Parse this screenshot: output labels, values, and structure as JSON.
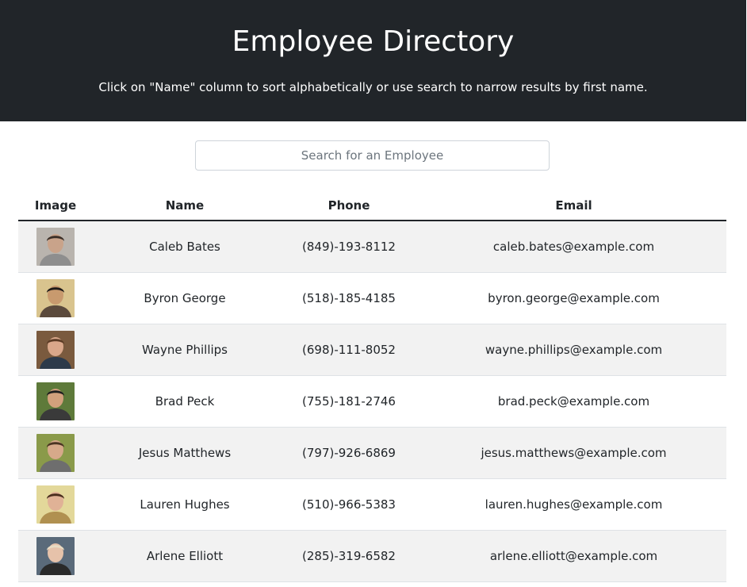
{
  "header": {
    "title": "Employee Directory",
    "subtitle": "Click on \"Name\" column to sort alphabetically or use search to narrow results by first name.",
    "background": "#212529"
  },
  "search": {
    "placeholder": "Search for an Employee",
    "value": ""
  },
  "table": {
    "columns": [
      "Image",
      "Name",
      "Phone",
      "Email"
    ],
    "rows": [
      {
        "name": "Caleb Bates",
        "phone": "(849)-193-8112",
        "email": "caleb.bates@example.com",
        "avatar": {
          "bg": "#b9b4ae",
          "skin": "#c9a38a",
          "hair": "#3a2e27",
          "shirt": "#8e8e8e"
        }
      },
      {
        "name": "Byron George",
        "phone": "(518)-185-4185",
        "email": "byron.george@example.com",
        "avatar": {
          "bg": "#d9c48e",
          "skin": "#c89a6e",
          "hair": "#1d1a18",
          "shirt": "#5b4a3c"
        }
      },
      {
        "name": "Wayne Phillips",
        "phone": "(698)-111-8052",
        "email": "wayne.phillips@example.com",
        "avatar": {
          "bg": "#7a5a3e",
          "skin": "#d9a78a",
          "hair": "#5a3a24",
          "shirt": "#2d3a4a"
        }
      },
      {
        "name": "Brad Peck",
        "phone": "(755)-181-2746",
        "email": "brad.peck@example.com",
        "avatar": {
          "bg": "#5e7a3a",
          "skin": "#d2a07c",
          "hair": "#1e1e1e",
          "shirt": "#3a3a3a"
        }
      },
      {
        "name": "Jesus Matthews",
        "phone": "(797)-926-6869",
        "email": "jesus.matthews@example.com",
        "avatar": {
          "bg": "#8a9a4a",
          "skin": "#d6a98a",
          "hair": "#4a3422",
          "shirt": "#6e6e6e"
        }
      },
      {
        "name": "Lauren Hughes",
        "phone": "(510)-966-5383",
        "email": "lauren.hughes@example.com",
        "avatar": {
          "bg": "#e3d89a",
          "skin": "#e0b296",
          "hair": "#4a2e1e",
          "shirt": "#b09050"
        }
      },
      {
        "name": "Arlene Elliott",
        "phone": "(285)-319-6582",
        "email": "arlene.elliott@example.com",
        "avatar": {
          "bg": "#5a6a7a",
          "skin": "#e6c2aa",
          "hair": "#e8dcc4",
          "shirt": "#2a2a2a"
        }
      }
    ]
  },
  "colors": {
    "stripe": "#f2f2f2",
    "text": "#212529",
    "border": "#dee2e6"
  }
}
